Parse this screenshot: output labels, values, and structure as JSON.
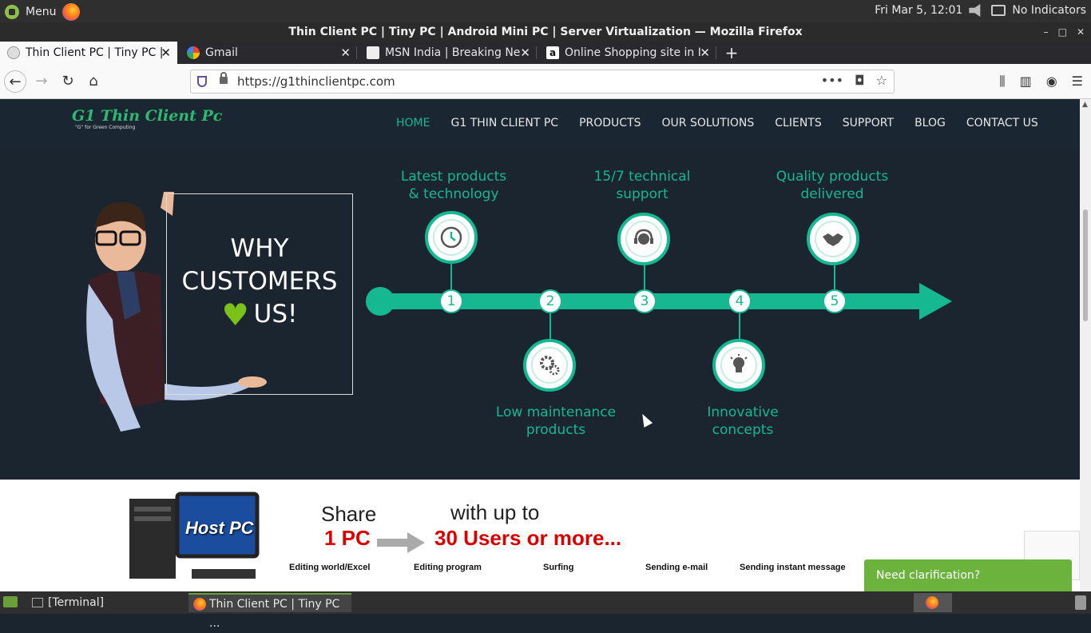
{
  "os_panel": {
    "menu_label": "Menu",
    "clock": "Fri Mar  5, 12:01",
    "indicators_label": "No Indicators"
  },
  "window": {
    "title": "Thin Client PC | Tiny PC | Android Mini PC | Server Virtualization — Mozilla Firefox"
  },
  "tabs": [
    {
      "label": "Thin Client PC | Tiny PC |",
      "active": true
    },
    {
      "label": "Gmail",
      "active": false
    },
    {
      "label": "MSN India | Breaking Ne",
      "active": false
    },
    {
      "label": "Online Shopping site in I",
      "active": false
    }
  ],
  "navbar": {
    "url": "https://g1thinclientpc.com"
  },
  "site": {
    "logo_name": "G1 Thin Client Pc",
    "logo_tagline": "\"G\" for Green Computing",
    "nav": [
      "HOME",
      "G1 THIN CLIENT PC",
      "PRODUCTS",
      "OUR SOLUTIONS",
      "CLIENTS",
      "SUPPORT",
      "BLOG",
      "CONTACT US"
    ],
    "active_nav": "HOME"
  },
  "hero": {
    "why_line1": "WHY",
    "why_line2": "CUSTOMERS",
    "why_line3": "US!",
    "features": [
      {
        "number": "1",
        "label_line1": "Latest products",
        "label_line2": "& technology",
        "icon": "clock-icon"
      },
      {
        "number": "2",
        "label_line1": "Low maintenance",
        "label_line2": "products",
        "icon": "gears-icon"
      },
      {
        "number": "3",
        "label_line1": "15/7 technical",
        "label_line2": "support",
        "icon": "headset-icon"
      },
      {
        "number": "4",
        "label_line1": "Innovative",
        "label_line2": "concepts",
        "icon": "lightbulb-icon"
      },
      {
        "number": "5",
        "label_line1": "Quality products",
        "label_line2": "delivered",
        "icon": "handshake-icon"
      }
    ],
    "accent_color": "#16b891"
  },
  "share": {
    "host_label": "Host PC",
    "share_word": "Share",
    "one_pc": "1 PC",
    "with_up_to": "with up to",
    "users_num": "30 Users",
    "or_more": "or more...",
    "captions": [
      "Editing world/Excel",
      "Editing program",
      "Surfing",
      "Sending e-mail",
      "Sending instant message"
    ]
  },
  "chat": {
    "label": "Need clarification?"
  },
  "taskbar": {
    "terminal_label": "[Terminal]",
    "firefox_label": "Thin Client PC | Tiny PC ..."
  }
}
